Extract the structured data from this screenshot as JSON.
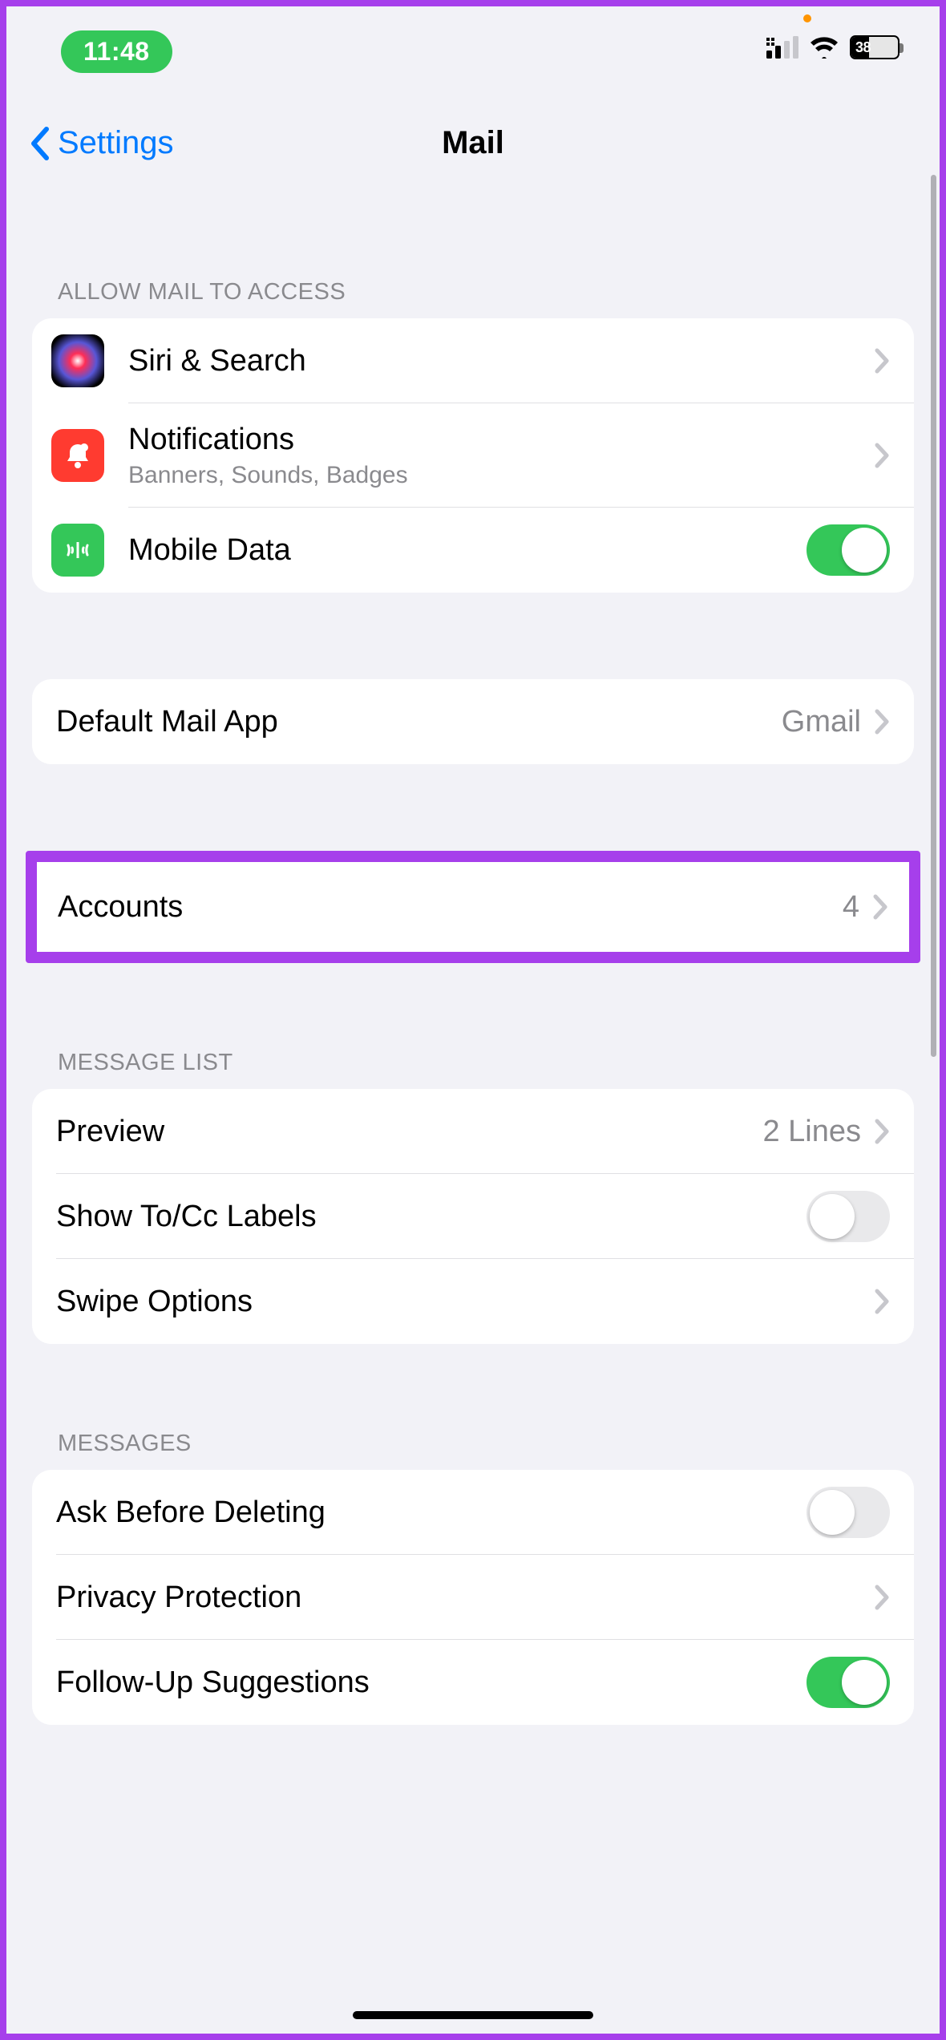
{
  "status": {
    "time": "11:48",
    "battery_pct": "38"
  },
  "nav": {
    "back_label": "Settings",
    "title": "Mail"
  },
  "sections": {
    "access": {
      "header": "ALLOW MAIL TO ACCESS",
      "siri": "Siri & Search",
      "notifications": "Notifications",
      "notifications_sub": "Banners, Sounds, Badges",
      "mobile_data": "Mobile Data",
      "mobile_data_on": true
    },
    "default_app": {
      "label": "Default Mail App",
      "value": "Gmail"
    },
    "accounts": {
      "label": "Accounts",
      "value": "4"
    },
    "message_list": {
      "header": "MESSAGE LIST",
      "preview": "Preview",
      "preview_value": "2 Lines",
      "show_tocc": "Show To/Cc Labels",
      "show_tocc_on": false,
      "swipe": "Swipe Options"
    },
    "messages": {
      "header": "MESSAGES",
      "ask_delete": "Ask Before Deleting",
      "ask_delete_on": false,
      "privacy": "Privacy Protection",
      "followup": "Follow-Up Suggestions",
      "followup_on": true
    }
  }
}
